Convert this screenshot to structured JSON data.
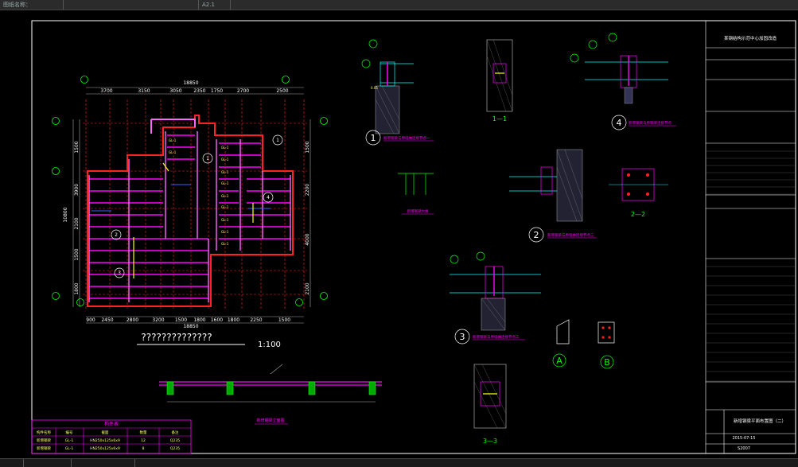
{
  "topbar": {
    "left_label": "图纸名称：",
    "sheet": "A2.1"
  },
  "plan": {
    "top_dims": [
      "3700",
      "3150",
      "3050",
      "2350",
      "1750",
      "2700",
      "2500"
    ],
    "top_total": "18850",
    "bottom_dims": [
      "900",
      "2450",
      "2800",
      "3200",
      "1500",
      "1800",
      "1600",
      "1800",
      "2250",
      "1500"
    ],
    "bottom_total": "18850",
    "left_dims": [
      "1500",
      "3900",
      "2100",
      "1500",
      "1800"
    ],
    "left_total": "10800",
    "right_dims": [
      "1500",
      "2200",
      "4000",
      "2100"
    ],
    "title_text": "??????????????",
    "scale": "1:100"
  },
  "details": {
    "d1": {
      "num": "1",
      "title": "新增钢梁与原墙体连接节点一"
    },
    "d2": {
      "num": "2",
      "title": "新增钢梁与原墙体连接节点二"
    },
    "d3": {
      "num": "3",
      "title": "新增钢梁与原墙体连接节点三"
    },
    "d4": {
      "num": "4",
      "title": "新增钢梁与原钢梁连接节点"
    },
    "s11": "1—1",
    "s22": "2—2",
    "s33": "3—3",
    "ma": "A",
    "mb": "B",
    "small_detail": "新增钢梁大样",
    "elev_title": "新增钢梁立面图"
  },
  "legend": {
    "title": "构件表",
    "headers": [
      "构件名称",
      "编号",
      "截面",
      "数量",
      "备注"
    ],
    "rows": [
      [
        "新增钢梁",
        "GL-1",
        "HN250x125x6x9",
        "12",
        "Q235"
      ],
      [
        "新增钢梁",
        "GL-1",
        "HN250x125x6x9",
        "8",
        "Q235"
      ]
    ]
  },
  "titleblock": {
    "project": "某钢结构示范中心加固改造",
    "drawing": "新增钢梁平面布置图（二）",
    "date": "2015-07-15",
    "number": "S2007"
  },
  "colors": {
    "bg": "#000000",
    "frame": "#ffffff",
    "green": "#00ff00",
    "magenta": "#ff00ff",
    "red": "#ff2222",
    "cyan": "#00ffff",
    "yellow": "#ffff00",
    "blue": "#3366ff"
  }
}
